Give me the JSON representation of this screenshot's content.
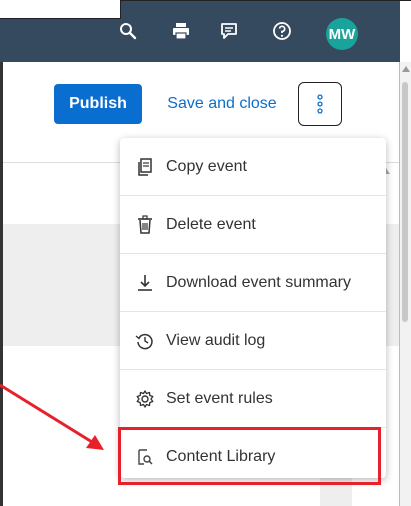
{
  "shell": {
    "avatar_initials": "MW",
    "icons": [
      "search-icon",
      "printer-icon",
      "feedback-icon",
      "help-icon"
    ],
    "bar_color": "#354a5f",
    "avatar_color": "#1aa39a"
  },
  "toolbar": {
    "publish_label": "Publish",
    "save_close_label": "Save and close",
    "more_icon": "vertical-ellipsis-icon",
    "accent": "#0a6ed1"
  },
  "menu": {
    "items": [
      {
        "label": "Copy event",
        "icon": "copy-icon"
      },
      {
        "label": "Delete event",
        "icon": "trash-icon"
      },
      {
        "label": "Download event summary",
        "icon": "download-icon"
      },
      {
        "label": "View audit log",
        "icon": "history-icon"
      },
      {
        "label": "Set event rules",
        "icon": "settings-gear-icon"
      },
      {
        "label": "Content Library",
        "icon": "content-library-icon"
      }
    ],
    "highlighted": "Content Library",
    "highlight_color": "#e8202a"
  }
}
